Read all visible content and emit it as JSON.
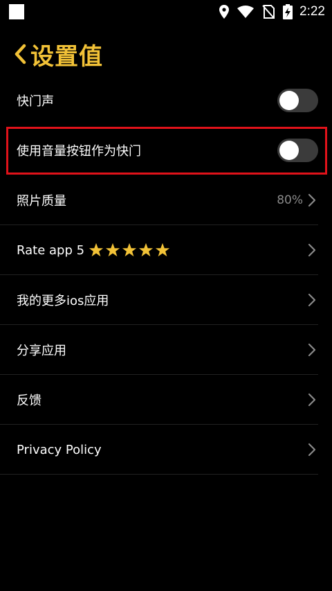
{
  "status_bar": {
    "time": "2:22",
    "icons": [
      "location-icon",
      "wifi-icon",
      "no-sim-icon",
      "battery-charging-icon"
    ]
  },
  "header": {
    "back_icon": "chevron-left-icon",
    "title": "设置值"
  },
  "colors": {
    "accent": "#f2c237",
    "highlight_border": "#e0121a",
    "toggle_off": "#3b3b3b",
    "value_gray": "#8a8a8a"
  },
  "settings": {
    "shutter_sound": {
      "label": "快门声",
      "enabled": false
    },
    "volume_button_shutter": {
      "label": "使用音量按钮作为快门",
      "enabled": false
    },
    "photo_quality": {
      "label": "照片质量",
      "value": "80%"
    },
    "rate_app": {
      "label": "Rate app 5",
      "stars": 5
    },
    "more_apps": {
      "label": "我的更多ios应用"
    },
    "share_app": {
      "label": "分享应用"
    },
    "feedback": {
      "label": "反馈"
    },
    "privacy_policy": {
      "label": "Privacy Policy"
    }
  }
}
